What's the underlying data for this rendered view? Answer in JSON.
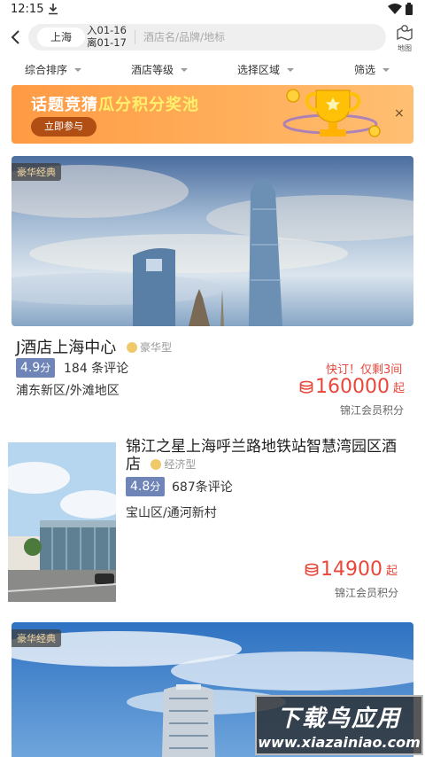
{
  "status_bar": {
    "time": "12:15"
  },
  "search": {
    "city": "上海",
    "checkin": "入01-16",
    "checkout": "离01-17",
    "placeholder": "酒店名/品牌/地标",
    "map_label": "地图"
  },
  "filters": [
    "综合排序",
    "酒店等级",
    "选择区域",
    "筛选"
  ],
  "banner": {
    "title_part1": "话题竞猜",
    "title_part2": "瓜分积分奖池",
    "button": "立即参与",
    "close": "×"
  },
  "hotels": [
    {
      "tag": "豪华经典",
      "name": "J酒店上海中心",
      "level": "豪华型",
      "score": "4.9",
      "score_unit": "分",
      "reviews": "184 条评论",
      "area": "浦东新区/外滩地区",
      "urgent": "快订！仅剩3间",
      "price": "160000",
      "price_suffix": "起",
      "price_type": "锦江会员积分"
    },
    {
      "name": "锦江之星上海呼兰路地铁站智慧湾园区酒店",
      "level": "经济型",
      "score": "4.8",
      "score_unit": "分",
      "reviews": "687条评论",
      "area": "宝山区/通河新村",
      "price": "14900",
      "price_suffix": "起",
      "price_type": "锦江会员积分"
    },
    {
      "tag": "豪华经典"
    }
  ],
  "watermark": {
    "line1": "下载鸟应用",
    "line2": "www.xiazainiao.com"
  },
  "colors": {
    "accent_red": "#e8473b",
    "score_blue": "#6f85b8",
    "banner_orange": "#ff9a44"
  }
}
